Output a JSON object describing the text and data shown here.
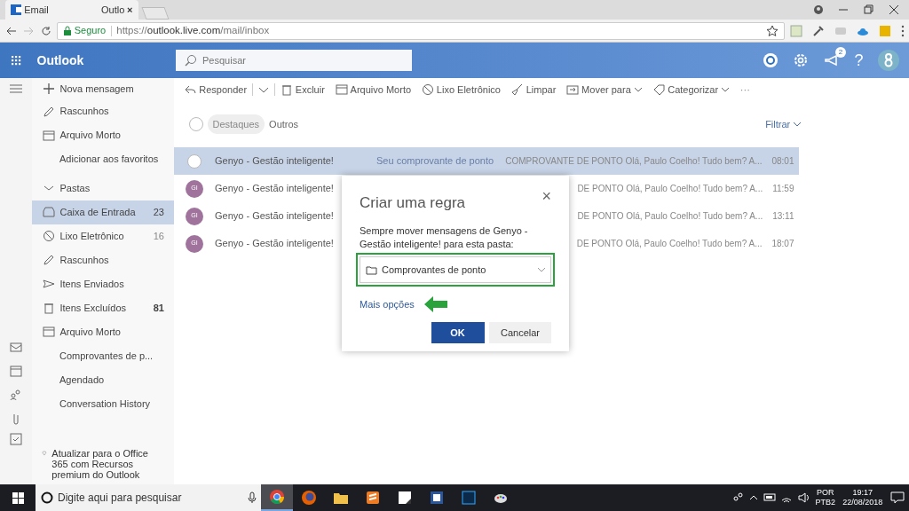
{
  "browser": {
    "tab": {
      "title": "Email",
      "title_2": "Outlo",
      "close": "×"
    },
    "address": {
      "security": "Seguro",
      "url_scheme": "https://",
      "url_host": "outlook.live.com",
      "url_path": "/mail/inbox"
    }
  },
  "header": {
    "app_name": "Outlook",
    "search": {
      "placeholder": "Pesquisar"
    },
    "notification_count": "2",
    "help": "?"
  },
  "sidebar": {
    "new_message": "Nova mensagem",
    "favorites": [
      {
        "label": "Rascunhos"
      },
      {
        "label": "Arquivo Morto"
      },
      {
        "label": "Adicionar aos favoritos"
      }
    ],
    "folders_heading": "Pastas",
    "folders_expanded": true,
    "folders": [
      {
        "label": "Caixa de Entrada",
        "count": "23",
        "selected": true,
        "bold_count": false
      },
      {
        "label": "Lixo Eletrônico",
        "count": "16",
        "selected": false,
        "bold_count": false
      },
      {
        "label": "Rascunhos",
        "selected": false
      },
      {
        "label": "Itens Enviados",
        "selected": false
      },
      {
        "label": "Itens Excluídos",
        "count": "81",
        "selected": false,
        "bold_count": true
      },
      {
        "label": "Arquivo Morto",
        "selected": false,
        "children": [
          {
            "label": "Comprovantes de p..."
          },
          {
            "label": "Agendado"
          },
          {
            "label": "Conversation History"
          }
        ]
      }
    ],
    "upgrade": "Atualizar para o Office 365 com Recursos premium do Outlook"
  },
  "toolbar": [
    {
      "label": "Responder",
      "dropdown": false
    },
    {
      "label": "Excluir",
      "dropdown": false
    },
    {
      "label": "Arquivo Morto",
      "dropdown": false
    },
    {
      "label": "Lixo Eletrônico",
      "dropdown": false
    },
    {
      "label": "Limpar",
      "dropdown": false
    },
    {
      "label": "Mover para",
      "dropdown": true
    },
    {
      "label": "Categorizar",
      "dropdown": true
    }
  ],
  "more": "···",
  "select_all": {
    "checked": false
  },
  "tabs": [
    {
      "label": "Destaques",
      "selected": true
    },
    {
      "label": "Outros",
      "selected": false
    }
  ],
  "filter": "Filtrar",
  "messages": [
    {
      "sender": "Genyo - Gestão inteligente!",
      "subject": "Seu comprovante de ponto",
      "preview": "COMPROVANTE DE PONTO Olá, Paulo Coelho! Tudo bem? A...",
      "time": "08:01",
      "selected": true
    },
    {
      "sender": "Genyo - Gestão inteligente!",
      "avatar": "GI",
      "preview": "DE PONTO Olá, Paulo Coelho! Tudo bem? A...",
      "time": "11:59",
      "selected": false
    },
    {
      "sender": "Genyo - Gestão inteligente!",
      "avatar": "GI",
      "preview": "DE PONTO Olá, Paulo Coelho! Tudo bem? A...",
      "time": "13:11",
      "selected": false
    },
    {
      "sender": "Genyo - Gestão inteligente!",
      "avatar": "GI",
      "preview": "DE PONTO Olá, Paulo Coelho! Tudo bem? A...",
      "time": "18:07",
      "selected": false
    }
  ],
  "dialog": {
    "title": "Criar uma regra",
    "close": "×",
    "text": "Sempre mover mensagens de Genyo - Gestão inteligente! para esta pasta:",
    "folder": "Comprovantes de ponto",
    "highlighted": true,
    "more_options": "Mais opções",
    "ok": "OK",
    "cancel": "Cancelar"
  },
  "taskbar": {
    "search": {
      "placeholder": "Digite aqui para pesquisar"
    },
    "apps": [
      {
        "selected": true
      },
      {
        "selected": false
      },
      {
        "selected": false
      },
      {
        "selected": false
      },
      {
        "selected": false
      },
      {
        "selected": false
      },
      {
        "selected": false
      },
      {
        "selected": false
      }
    ],
    "language": "POR",
    "layout": "PTB2",
    "time": "19:17",
    "date": "22/08/2018"
  }
}
